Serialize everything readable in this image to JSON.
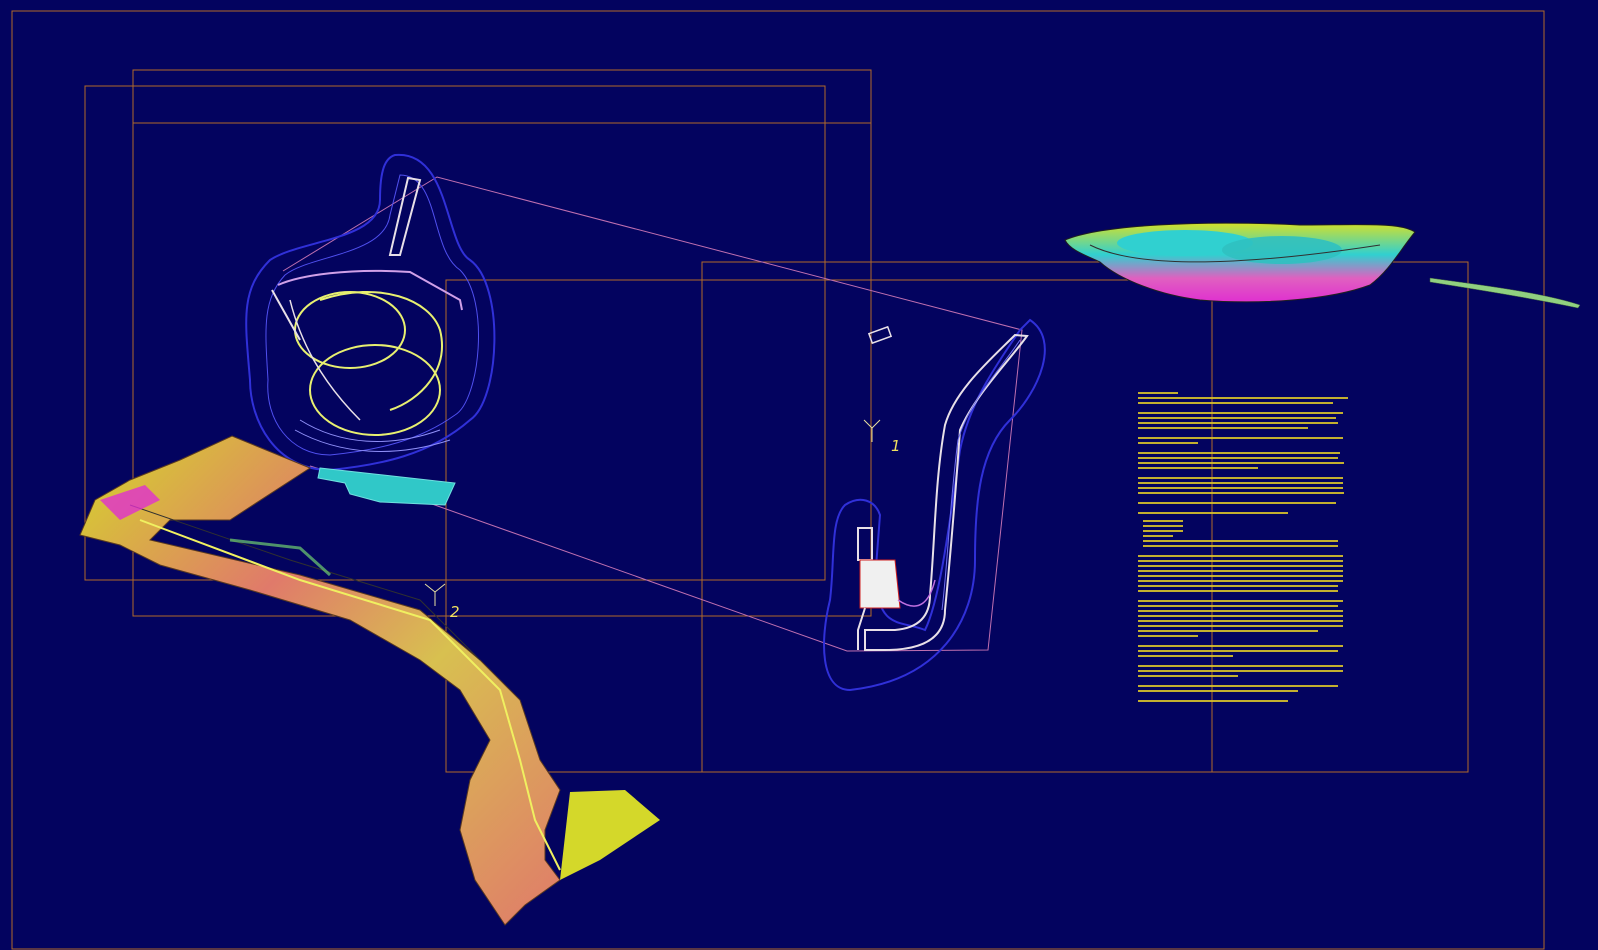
{
  "drawing": {
    "background_color": "#03035f",
    "frame_color": "#b06a2a",
    "markers": [
      {
        "id": "marker-1",
        "label": "1"
      },
      {
        "id": "marker-2",
        "label": "2"
      }
    ],
    "note_text_color": "#d8c22a",
    "surface_colors": [
      "#d4d82a",
      "#e07a6a",
      "#e030d0",
      "#30d0d0",
      "#70d070"
    ]
  }
}
